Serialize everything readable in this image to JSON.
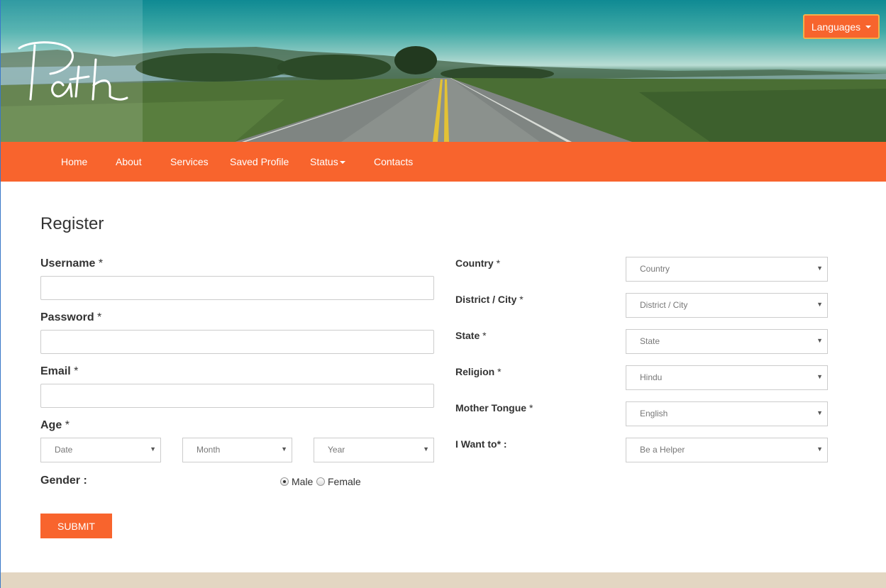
{
  "header": {
    "logo_text": "Path",
    "languages_label": "Languages"
  },
  "nav": {
    "items": [
      {
        "label": "Home"
      },
      {
        "label": "About"
      },
      {
        "label": "Services"
      },
      {
        "label": "Saved Profile"
      },
      {
        "label": "Status"
      },
      {
        "label": "Contacts"
      }
    ]
  },
  "form": {
    "title": "Register",
    "username_label": "Username",
    "password_label": "Password",
    "email_label": "Email",
    "age_label": "Age",
    "required_mark": "*",
    "age_selects": {
      "date": "Date",
      "month": "Month",
      "year": "Year"
    },
    "gender_label": "Gender :",
    "gender_options": [
      {
        "label": "Male",
        "selected": true
      },
      {
        "label": "Female",
        "selected": false
      }
    ],
    "submit_label": "SUBMIT",
    "right_fields": [
      {
        "label": "Country",
        "suffix": "*",
        "value": "Country"
      },
      {
        "label": "District / City",
        "suffix": "*",
        "value": "District / City"
      },
      {
        "label": "State",
        "suffix": "*",
        "value": "State"
      },
      {
        "label": "Religion",
        "suffix": "*",
        "value": "Hindu"
      },
      {
        "label": "Mother Tongue",
        "suffix": "*",
        "value": "English"
      },
      {
        "label": "I Want to* :",
        "suffix": "",
        "value": "Be a Helper"
      }
    ]
  },
  "colors": {
    "accent": "#f8642d",
    "footer": "#e3d6c2"
  }
}
